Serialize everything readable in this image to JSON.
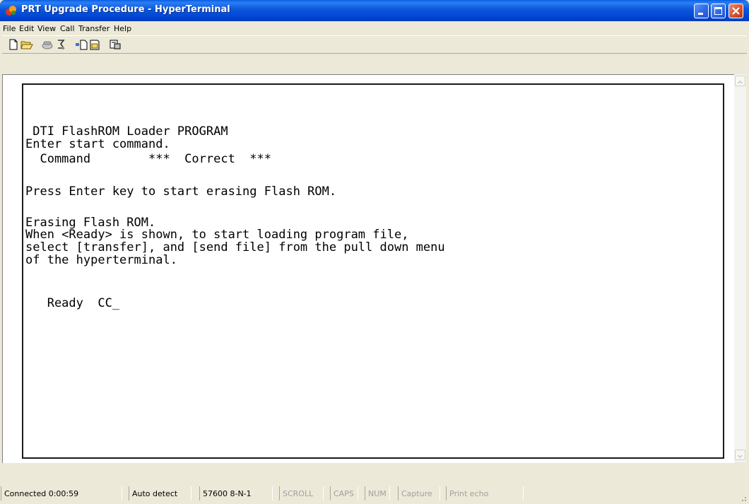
{
  "window": {
    "title": "PRT Upgrade Procedure - HyperTerminal"
  },
  "menu": [
    "File",
    "Edit",
    "View",
    "Call",
    "Transfer",
    "Help"
  ],
  "toolbar": {
    "buttons": [
      "new-icon",
      "open-icon",
      "call-icon",
      "disconnect-icon",
      "send-icon",
      "receive-icon",
      "properties-icon"
    ]
  },
  "terminal": {
    "lines": [
      " DTI FlashROM Loader PROGRAM",
      "Enter start command.",
      "  Command        ***  Correct  ***",
      "",
      "Press Enter key to start erasing Flash ROM.",
      "",
      "Erasing Flash ROM.",
      "When <Ready> is shown, to start loading program file,",
      "select [transfer], and [send file] from the pull down menu",
      "of the hyperterminal.",
      "",
      "   Ready  CC_"
    ]
  },
  "status": {
    "connected": "Connected 0:00:59",
    "detect": "Auto detect",
    "settings": "57600 8-N-1",
    "scroll": "SCROLL",
    "caps": "CAPS",
    "num": "NUM",
    "capture": "Capture",
    "print_echo": "Print echo"
  },
  "colors": {
    "titlebar": "#0046d5",
    "window_bg": "#ece9d8",
    "terminal_bg": "#ffffff",
    "terminal_text": "#000000"
  }
}
